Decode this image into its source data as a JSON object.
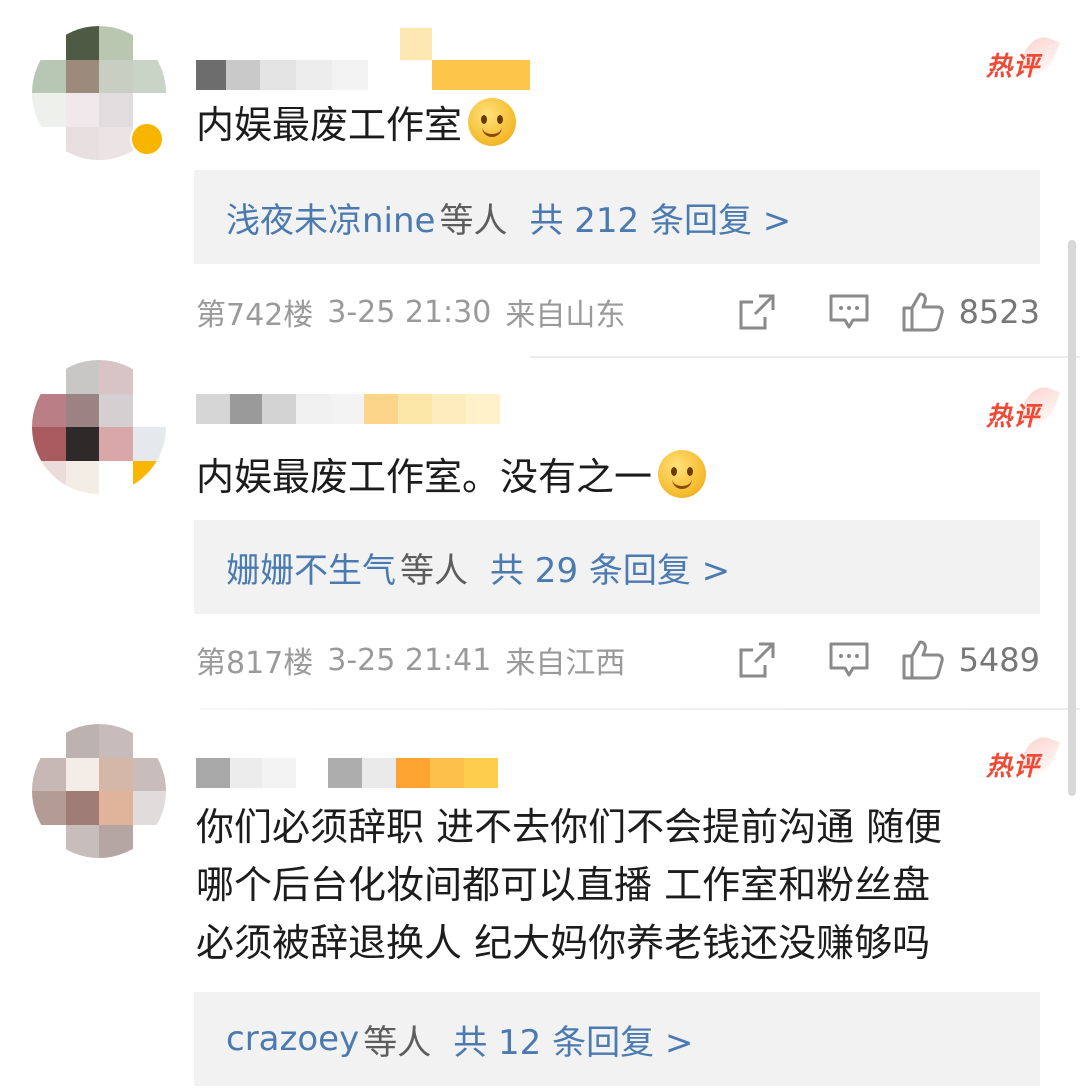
{
  "hot_label": "热评",
  "reply_suffix": "等人",
  "comments": [
    {
      "text": "内娱最废工作室",
      "emoji": "smirk-emoji",
      "reply_from": "浅夜未凉nine",
      "reply_count": "共 212 条回复 >",
      "floor": "第742楼",
      "date": "3-25 21:30",
      "location": "来自山东",
      "likes": "8523"
    },
    {
      "text": "内娱最废工作室。没有之一",
      "emoji": "smile-emoji",
      "reply_from": "姗姗不生气",
      "reply_count": "共 29 条回复 >",
      "floor": "第817楼",
      "date": "3-25 21:41",
      "location": "来自江西",
      "likes": "5489"
    },
    {
      "text": "你们必须辞职 进不去你们不会提前沟通 随便\n哪个后台化妆间都可以直播 工作室和粉丝盘\n必须被辞退换人 纪大妈你养老钱还没赚够吗",
      "reply_from": "crazoey",
      "reply_count": "共 12 条回复 >"
    }
  ],
  "colors": {
    "hot": "#f04a36",
    "link": "#4a7ab0",
    "reply_bg": "#f2f2f2",
    "meta": "#9a9a9a"
  }
}
